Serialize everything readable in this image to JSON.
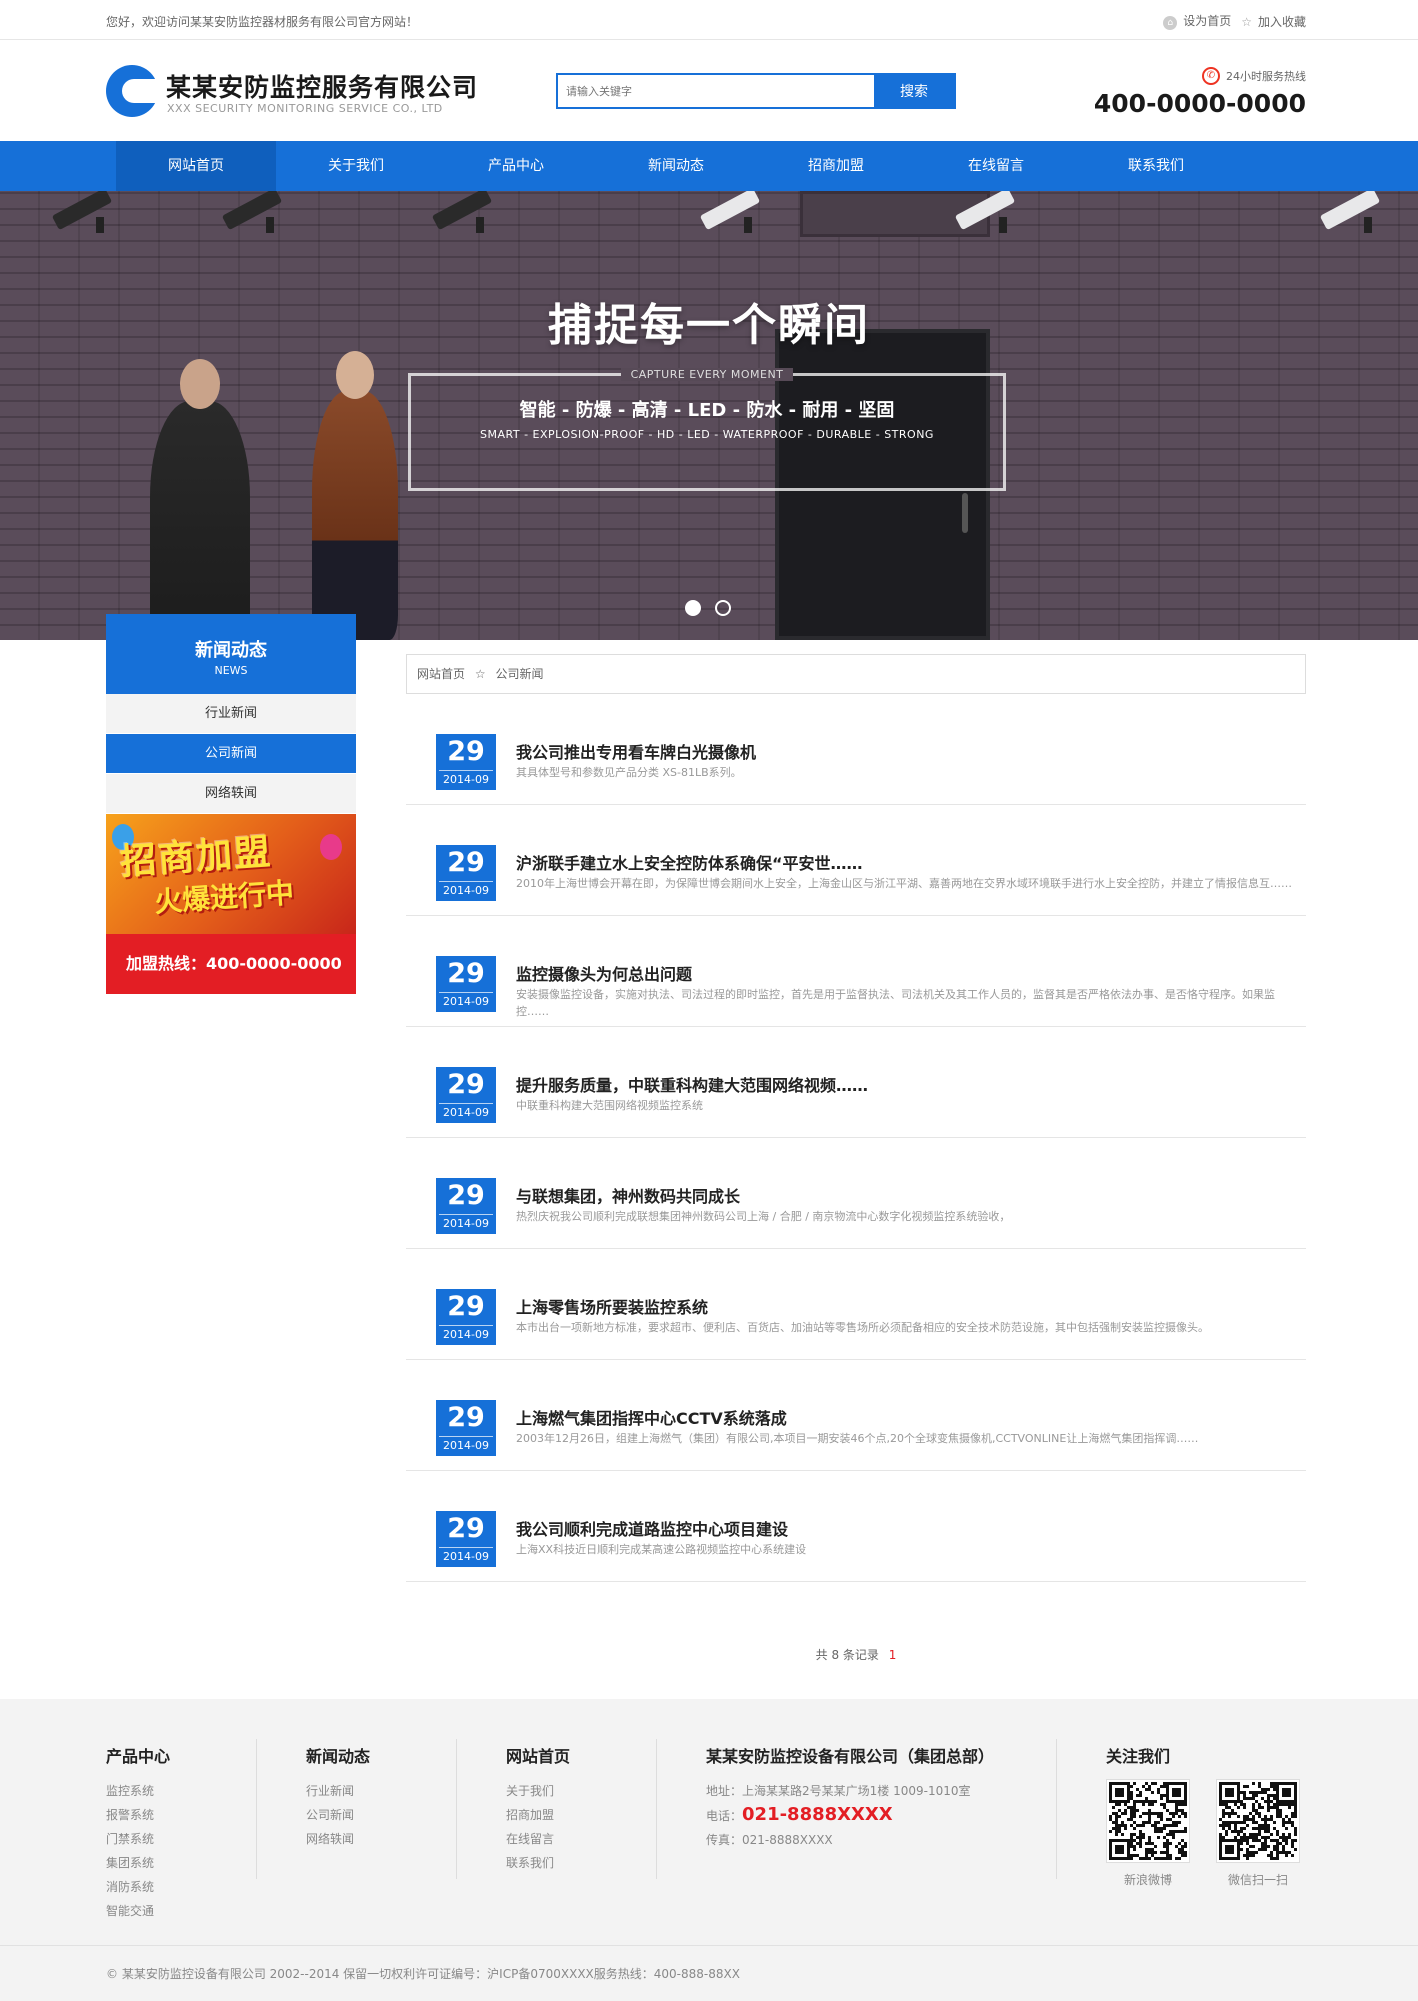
{
  "topbar": {
    "welcome": "您好，欢迎访问某某安防监控器材服务有限公司官方网站！",
    "set_home": "设为首页",
    "favorite": "加入收藏"
  },
  "header": {
    "logo_title": "某某安防监控服务有限公司",
    "logo_sub": "XXX SECURITY MONITORING SERVICE CO., LTD",
    "search_placeholder": "请输入关键字",
    "search_button": "搜索",
    "hotline_label": "24小时服务热线",
    "hotline_number": "400-0000-0000"
  },
  "nav": [
    "网站首页",
    "关于我们",
    "产品中心",
    "新闻动态",
    "招商加盟",
    "在线留言",
    "联系我们"
  ],
  "banner": {
    "title": "捕捉每一个瞬间",
    "caption": "CAPTURE EVERY MOMENT",
    "features": "智能 - 防爆 - 高清 - LED - 防水 - 耐用 - 坚固",
    "features_en": "SMART - EXPLOSION-PROOF - HD - LED - WATERPROOF - DURABLE - STRONG"
  },
  "sidebar": {
    "title": "新闻动态",
    "subtitle": "NEWS",
    "items": [
      "行业新闻",
      "公司新闻",
      "网络轶闻"
    ],
    "promo_line1": "招商加盟",
    "promo_line2": "火爆进行中",
    "hotline": "加盟热线：400-0000-0000"
  },
  "breadcrumb": {
    "home": "网站首页",
    "sep": "☆",
    "current": "公司新闻"
  },
  "news": [
    {
      "day": "29",
      "month": "2014-09",
      "title": "我公司推出专用看车牌白光摄像机",
      "desc": "其具体型号和参数见产品分类 XS-81LB系列。"
    },
    {
      "day": "29",
      "month": "2014-09",
      "title": "沪浙联手建立水上安全控防体系确保“平安世……",
      "desc": "2010年上海世博会开幕在即，为保障世博会期间水上安全，上海金山区与浙江平湖、嘉善两地在交界水域环境联手进行水上安全控防，并建立了情报信息互……"
    },
    {
      "day": "29",
      "month": "2014-09",
      "title": "监控摄像头为何总出问题",
      "desc": "安装摄像监控设备，实施对执法、司法过程的即时监控，首先是用于监督执法、司法机关及其工作人员的，监督其是否严格依法办事、是否恪守程序。如果监控……"
    },
    {
      "day": "29",
      "month": "2014-09",
      "title": "提升服务质量，中联重科构建大范围网络视频……",
      "desc": "中联重科构建大范围网络视频监控系统"
    },
    {
      "day": "29",
      "month": "2014-09",
      "title": "与联想集团，神州数码共同成长",
      "desc": "热烈庆祝我公司顺利完成联想集团神州数码公司上海 / 合肥 / 南京物流中心数字化视频监控系统验收，"
    },
    {
      "day": "29",
      "month": "2014-09",
      "title": "上海零售场所要装监控系统",
      "desc": "本市出台一项新地方标准，要求超市、便利店、百货店、加油站等零售场所必须配备相应的安全技术防范设施，其中包括强制安装监控摄像头。"
    },
    {
      "day": "29",
      "month": "2014-09",
      "title": "上海燃气集团指挥中心CCTV系统落成",
      "desc": "2003年12月26日，组建上海燃气（集团）有限公司,本项目一期安装46个点,20个全球变焦摄像机,CCTVONLINE让上海燃气集团指挥调……"
    },
    {
      "day": "29",
      "month": "2014-09",
      "title": "我公司顺利完成道路监控中心项目建设",
      "desc": "上海XX科技近日顺利完成某高速公路视频监控中心系统建设"
    }
  ],
  "pager": {
    "text": "共 8 条记录",
    "page": "1"
  },
  "footer": {
    "products": {
      "title": "产品中心",
      "items": [
        "监控系统",
        "报警系统",
        "门禁系统",
        "集团系统",
        "消防系统",
        "智能交通"
      ]
    },
    "news": {
      "title": "新闻动态",
      "items": [
        "行业新闻",
        "公司新闻",
        "网络轶闻"
      ]
    },
    "site": {
      "title": "网站首页",
      "items": [
        "关于我们",
        "招商加盟",
        "在线留言",
        "联系我们"
      ]
    },
    "contact": {
      "title": "某某安防监控设备有限公司（集团总部）",
      "address": "地址：上海某某路2号某某广场1楼 1009-1010室",
      "tel_label": "电话：",
      "tel": "021-8888XXXX",
      "fax": "传真：021-8888XXXX"
    },
    "follow": {
      "title": "关注我们",
      "qr1": "新浪微博",
      "qr2": "微信扫一扫"
    },
    "copyright": "© 某某安防监控设备有限公司 2002--2014 保留一切权利许可证编号：沪ICP备0700XXXX服务热线：400-888-88XX"
  }
}
